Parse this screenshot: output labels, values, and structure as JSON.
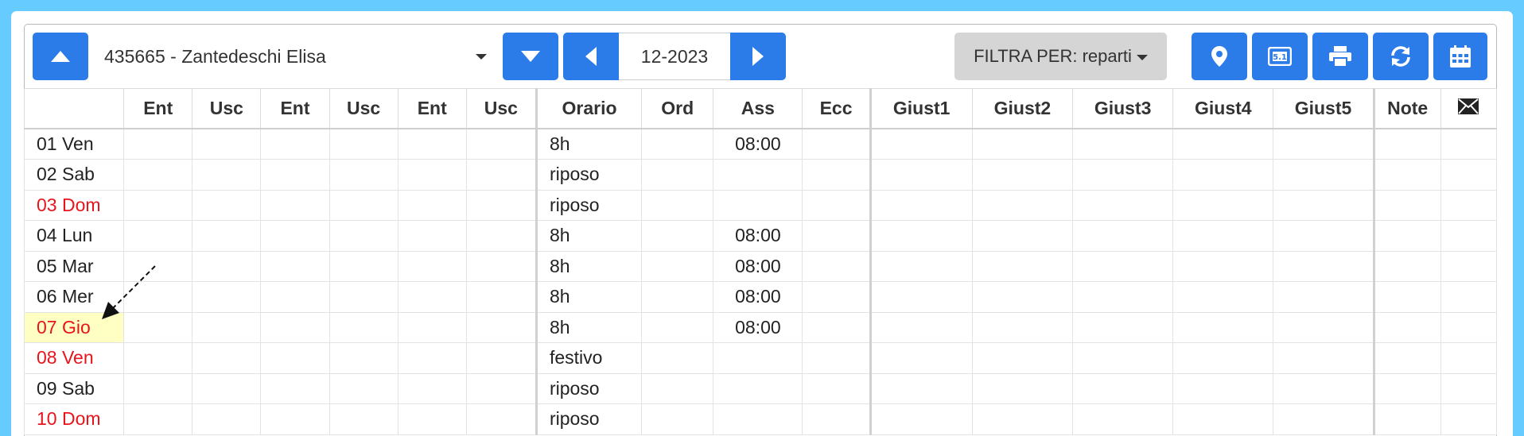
{
  "toolbar": {
    "employee": "435665 - Zantedeschi Elisa",
    "month": "12-2023",
    "filter_label": "FILTRA PER: reparti"
  },
  "icons": {
    "prev_employee": "chevron-up-icon",
    "next_employee": "chevron-down-icon",
    "prev_month": "caret-left-icon",
    "next_month": "caret-right-icon",
    "location": "map-marker-icon",
    "badge": "id-card-icon",
    "print": "printer-icon",
    "refresh": "refresh-icon",
    "calendar": "calendar-icon",
    "mail": "envelope-icon"
  },
  "colors": {
    "primary_button": "#2b7ce8",
    "background": "#66ccff",
    "holiday_text": "#e8141c",
    "highlight_cell": "#ffffc4"
  },
  "table": {
    "columns": [
      "",
      "Ent",
      "Usc",
      "Ent",
      "Usc",
      "Ent",
      "Usc",
      "Orario",
      "Ord",
      "Ass",
      "Ecc",
      "Giust1",
      "Giust2",
      "Giust3",
      "Giust4",
      "Giust5",
      "Note",
      ""
    ],
    "rows": [
      {
        "day": "01 Ven",
        "orario": "8h",
        "ass": "08:00"
      },
      {
        "day": "02 Sab",
        "orario": "riposo",
        "ass": ""
      },
      {
        "day": "03 Dom",
        "orario": "riposo",
        "ass": ""
      },
      {
        "day": "04 Lun",
        "orario": "8h",
        "ass": "08:00"
      },
      {
        "day": "05 Mar",
        "orario": "8h",
        "ass": "08:00"
      },
      {
        "day": "06 Mer",
        "orario": "8h",
        "ass": "08:00"
      },
      {
        "day": "07 Gio",
        "orario": "8h",
        "ass": "08:00"
      },
      {
        "day": "08 Ven",
        "orario": "festivo",
        "ass": ""
      },
      {
        "day": "09 Sab",
        "orario": "riposo",
        "ass": ""
      },
      {
        "day": "10 Dom",
        "orario": "riposo",
        "ass": ""
      }
    ]
  }
}
